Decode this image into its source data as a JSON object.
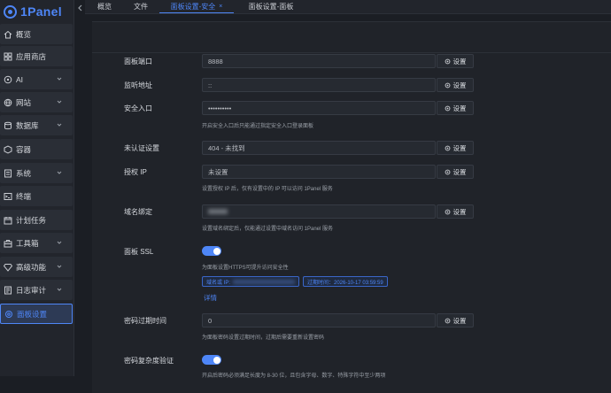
{
  "app": {
    "logo_text": "1Panel"
  },
  "sidebar": {
    "items": [
      {
        "label": "概览",
        "icon": "home-icon",
        "chevron": false
      },
      {
        "label": "应用商店",
        "icon": "store-icon",
        "chevron": false
      },
      {
        "label": "AI",
        "icon": "ai-icon",
        "chevron": true
      },
      {
        "label": "网站",
        "icon": "globe-icon",
        "chevron": true
      },
      {
        "label": "数据库",
        "icon": "database-icon",
        "chevron": true
      },
      {
        "label": "容器",
        "icon": "container-icon",
        "chevron": false
      },
      {
        "label": "系统",
        "icon": "system-icon",
        "chevron": true
      },
      {
        "label": "终端",
        "icon": "terminal-icon",
        "chevron": false
      },
      {
        "label": "计划任务",
        "icon": "calendar-icon",
        "chevron": false
      },
      {
        "label": "工具箱",
        "icon": "toolbox-icon",
        "chevron": true
      },
      {
        "label": "高级功能",
        "icon": "diamond-icon",
        "chevron": true
      },
      {
        "label": "日志审计",
        "icon": "log-icon",
        "chevron": true
      },
      {
        "label": "面板设置",
        "icon": "settings-icon",
        "chevron": false,
        "active": true
      }
    ]
  },
  "tabs": [
    {
      "label": "概览"
    },
    {
      "label": "文件"
    },
    {
      "label": "面板设置-安全",
      "active": true,
      "closable": true,
      "close": "×"
    },
    {
      "label": "面板设置-面板"
    }
  ],
  "settings": {
    "button_label": "设置",
    "rows": {
      "port": {
        "label": "面板端口",
        "value": "8888"
      },
      "listen": {
        "label": "监听地址",
        "value": "::"
      },
      "entrance": {
        "label": "安全入口",
        "value": "••••••••••",
        "help": "开启安全入口后只能通过指定安全入口登录面板"
      },
      "unauth": {
        "label": "未认证设置",
        "value": "404 - 未找到"
      },
      "auth_ip": {
        "label": "授权 IP",
        "value": "未设置",
        "help": "设置授权 IP 后，仅有设置中的 IP 可以访问 1Panel 服务"
      },
      "domain": {
        "label": "域名绑定",
        "help": "设置域名绑定后，仅能通过设置中域名访问 1Panel 服务"
      },
      "ssl": {
        "label": "面板 SSL",
        "enabled": true,
        "help": "为面板设置HTTPS可提升访问安全性",
        "domain_tag": "域名或 IP:",
        "expire_tag": "过期时间：2026-10-17 03:59:59",
        "detail_link": "详情"
      },
      "expire": {
        "label": "密码过期时间",
        "value": "0",
        "help": "为面板密码设置过期时间，过期后需要重新设置密码"
      },
      "complexity": {
        "label": "密码复杂度验证",
        "enabled": true,
        "help": "开启后密码必须满足长度为 8-30 位，且包含字母、数字、特殊字符中至少两项"
      }
    }
  },
  "colors": {
    "accent": "#4e86f7",
    "background": "#1b1e24",
    "sidebar": "#22252c"
  }
}
